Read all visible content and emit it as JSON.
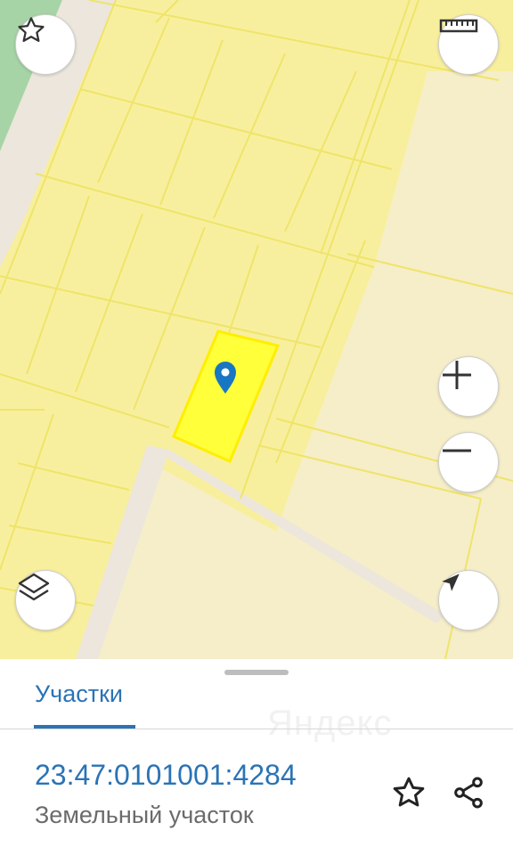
{
  "map": {
    "colors": {
      "park": "#a6d4a6",
      "road": "#ece6dc",
      "parcel_fill": "#f8ef9e",
      "parcel_line": "#efe46a",
      "block_fill": "#f6eec8",
      "selected_parcel": "#ffff3a",
      "selected_outline": "#ffee00",
      "marker": "#1976c2"
    },
    "controls": {
      "favorite": "star-icon",
      "ruler": "ruler-icon",
      "zoom_in": "plus-icon",
      "zoom_out": "minus-icon",
      "layers": "layers-icon",
      "locate": "navigation-arrow-icon"
    }
  },
  "sheet": {
    "tab_label": "Участки",
    "watermark": "Яндекс",
    "cadastral_number": "23:47:0101001:4284",
    "object_type": "Земельный участок",
    "actions": {
      "favorite": "star-outline-icon",
      "share": "share-icon"
    }
  }
}
